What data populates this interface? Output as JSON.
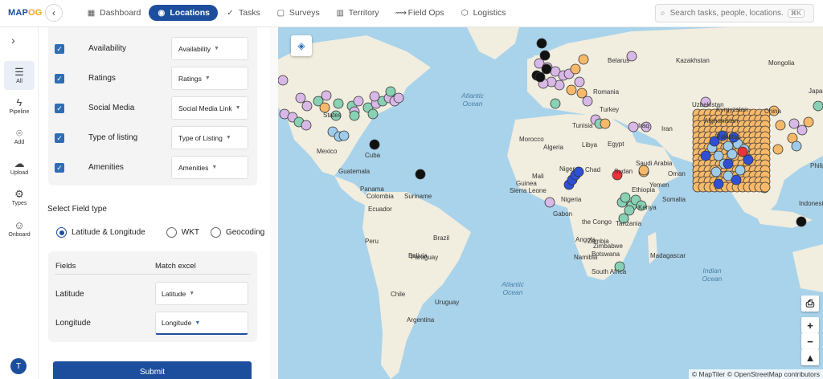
{
  "app": {
    "logo_main": "MAP",
    "logo_accent": "OG"
  },
  "nav": [
    {
      "label": "Dashboard",
      "icon": "dashboard-icon",
      "glyph": "▦"
    },
    {
      "label": "Locations",
      "icon": "location-pin-icon",
      "glyph": "◉"
    },
    {
      "label": "Tasks",
      "icon": "check-icon",
      "glyph": "✓"
    },
    {
      "label": "Surveys",
      "icon": "clipboard-icon",
      "glyph": "▢"
    },
    {
      "label": "Territory",
      "icon": "map-icon",
      "glyph": "▥"
    },
    {
      "label": "Field Ops",
      "icon": "route-icon",
      "glyph": "⟿"
    },
    {
      "label": "Logistics",
      "icon": "box-icon",
      "glyph": "⬡"
    }
  ],
  "search": {
    "placeholder": "Search tasks, people, locations...",
    "shortcut": "⌘K"
  },
  "leftnav": [
    {
      "label": "All",
      "icon": "list-icon",
      "glyph": "☰"
    },
    {
      "label": "Pipeline",
      "icon": "bolt-icon",
      "glyph": "ϟ"
    },
    {
      "label": "Add",
      "icon": "pin-icon",
      "glyph": "⌾"
    },
    {
      "label": "Upload",
      "icon": "cloud-upload-icon",
      "glyph": "☁"
    },
    {
      "label": "Types",
      "icon": "gear-icon",
      "glyph": "⚙"
    },
    {
      "label": "Onboard",
      "icon": "user-add-icon",
      "glyph": "☺"
    }
  ],
  "user": {
    "initial": "T"
  },
  "filters": [
    {
      "label": "Availability",
      "select": "Availability"
    },
    {
      "label": "Ratings",
      "select": "Ratings"
    },
    {
      "label": "Social Media",
      "select": "Social Media Link"
    },
    {
      "label": "Type of listing",
      "select": "Type of Listing"
    },
    {
      "label": "Amenities",
      "select": "Amenities"
    }
  ],
  "field_type": {
    "title": "Select Field type",
    "options": [
      "Latitude & Longitude",
      "WKT",
      "Geocoding"
    ],
    "selected": "Latitude & Longitude"
  },
  "mapping": {
    "header_fields": "Fields",
    "header_match": "Match excel",
    "rows": [
      {
        "field": "Latitude",
        "value": "Latitude"
      },
      {
        "field": "Longitude",
        "value": "Longitude"
      }
    ]
  },
  "submit_label": "Submit",
  "map": {
    "attribution": "© MapTiler © OpenStreetMap contributors",
    "labels": [
      "States",
      "Mexico",
      "Cuba",
      "Guatemala",
      "Panama",
      "Colombia",
      "Suriname",
      "Ecuador",
      "Peru",
      "Brazil",
      "Bolivia",
      "Paraguay",
      "Chile",
      "Argentina",
      "Uruguay",
      "Tunisia",
      "Morocco",
      "Libya",
      "Egypt",
      "Iraq",
      "Iran",
      "Saudi Arabia",
      "Turkey",
      "Romania",
      "Belarus",
      "Kazakhstan",
      "Mongolia",
      "Algeria",
      "Mali",
      "Niger",
      "Chad",
      "Sudan",
      "Ethiopia",
      "Guinea",
      "Sierra Leone",
      "Nigeria",
      "Gabon",
      "the Congo",
      "Tanzania",
      "Angola",
      "Zambia",
      "Namibia",
      "Zimbabwe",
      "Botswana",
      "South Africa",
      "Madagascar",
      "Somalia",
      "Kenya",
      "Oman",
      "Yemen",
      "Afghanistan",
      "Uzbekistan",
      "Kyrgyzstan",
      "Pakistan",
      "China",
      "Japan",
      "Philippines",
      "Indonesia"
    ],
    "oceans": [
      "Atlantic Ocean",
      "Atlantic Ocean",
      "Indian Ocean"
    ],
    "colors": {
      "land": "#f1eddf",
      "water": "#a9d3ea",
      "orange": "#f6b96a",
      "lilac": "#d8b8e6",
      "teal": "#88d1b4",
      "blue": "#2f4fd6",
      "lightblue": "#9ecbea",
      "black": "#111111",
      "red": "#e8343a"
    }
  }
}
